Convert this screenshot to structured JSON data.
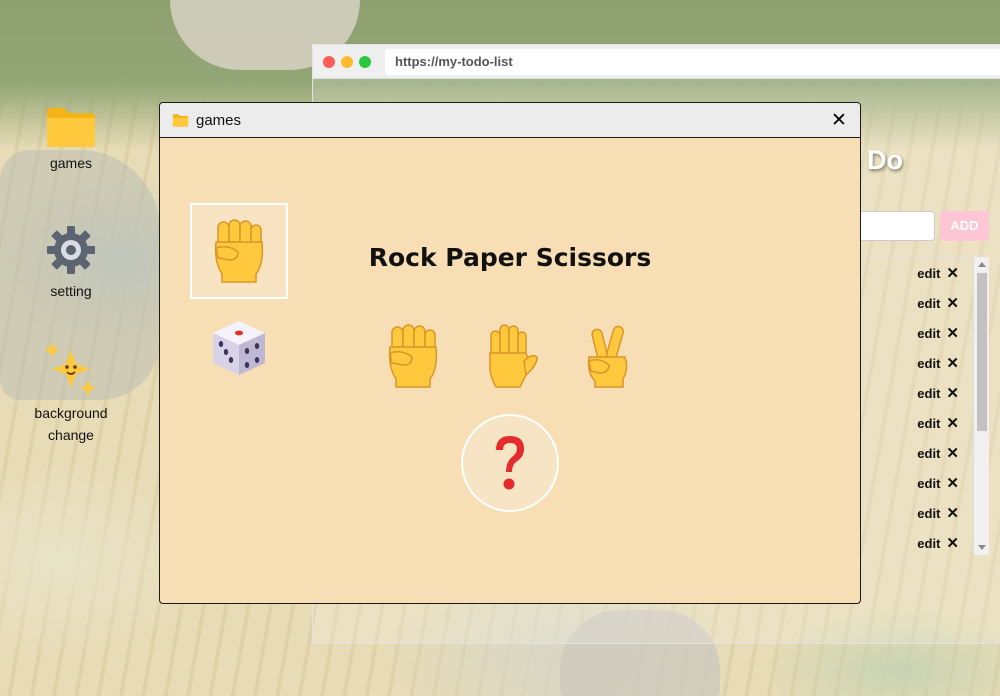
{
  "desktop": {
    "icons": [
      {
        "label": "games",
        "icon": "folder-icon"
      },
      {
        "label": "setting",
        "icon": "gear-icon"
      },
      {
        "label": "background change",
        "icon": "sparkles-icon"
      }
    ]
  },
  "browser": {
    "url": "https://my-todo-list",
    "title_partial": "o Do",
    "add_label": "ADD",
    "rows": [
      {
        "edit": "edit",
        "delete": "✕"
      },
      {
        "edit": "edit",
        "delete": "✕"
      },
      {
        "edit": "edit",
        "delete": "✕"
      },
      {
        "edit": "edit",
        "delete": "✕"
      },
      {
        "edit": "edit",
        "delete": "✕"
      },
      {
        "edit": "edit",
        "delete": "✕"
      },
      {
        "edit": "edit",
        "delete": "✕"
      },
      {
        "edit": "edit",
        "delete": "✕"
      },
      {
        "edit": "edit",
        "delete": "✕"
      },
      {
        "edit": "edit",
        "delete": "✕"
      }
    ]
  },
  "games_window": {
    "title": "games",
    "close_glyph": "✕",
    "tabs": [
      {
        "icon": "raised-fist-icon",
        "active": true
      },
      {
        "icon": "dice-icon",
        "active": false
      }
    ],
    "game_title": "Rock Paper Scissors",
    "choices": [
      {
        "icon": "rock-fist-icon"
      },
      {
        "icon": "paper-hand-icon"
      },
      {
        "icon": "scissors-hand-icon"
      }
    ],
    "result_glyph": "?",
    "result_icon": "question-mark-icon"
  },
  "colors": {
    "window_bg": "#f7deb4",
    "folder": "#ffc83d",
    "hand": "#ffc83d",
    "question": "#e52b2b",
    "add_button": "#ffc7d6"
  }
}
